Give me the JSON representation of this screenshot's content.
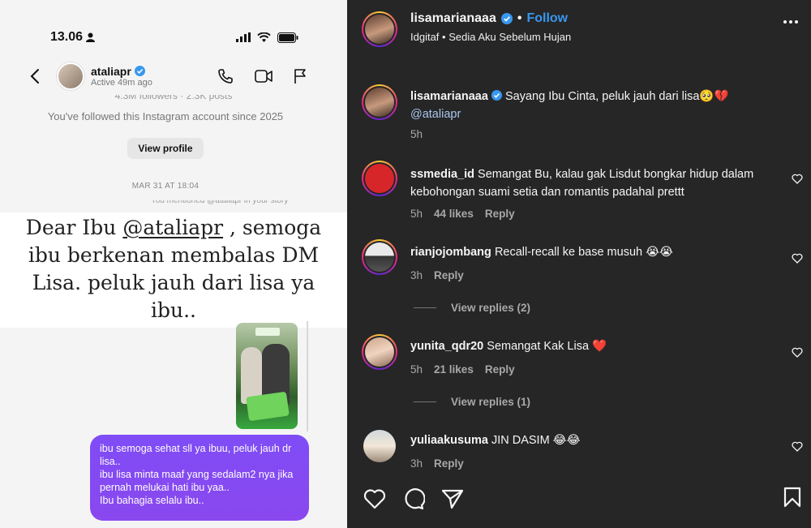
{
  "dm": {
    "status": {
      "time": "13.06"
    },
    "header": {
      "username": "ataliapr",
      "active": "Active 49m ago"
    },
    "followers_partial": "4.3M followers · 2.3K posts",
    "followed_since": "You've followed this Instagram account since 2025",
    "view_profile": "View profile",
    "date": "MAR 31 AT 18:04",
    "mentioned_partial": "You mentioned @ataliapr in your story",
    "overlay": {
      "line_prefix": "Dear Ibu ",
      "mention": "@ataliapr",
      "line_suffix": " , semoga ibu berkenan membalas DM Lisa. peluk jauh dari lisa ya ibu.."
    },
    "bubble": {
      "line1": "ibu semoga sehat sll ya ibuu, peluk jauh dr lisa..",
      "line2": "ibu lisa minta maaf yang sedalam2 nya jika pernah melukai hati ibu yaa..",
      "line3": "Ibu bahagia selalu ibu.."
    }
  },
  "post": {
    "username": "lisamarianaaa",
    "separator": "•",
    "follow": "Follow",
    "music": "Idgitaf • Sedia Aku Sebelum Hujan"
  },
  "comments": [
    {
      "username": "lisamarianaaa",
      "text": "Sayang Ibu Cinta, peluk jauh dari lisa🥺💔",
      "mention": "@ataliapr",
      "time": "5h"
    },
    {
      "username": "ssmedia_id",
      "text": "Semangat Bu, kalau gak Lisdut bongkar hidup dalam kebohongan suami setia dan romantis padahal prettt",
      "time": "5h",
      "likes": "44 likes",
      "reply": "Reply"
    },
    {
      "username": "rianjojombang",
      "text": "Recall-recall ke base musuh 😭😭",
      "time": "3h",
      "reply": "Reply",
      "view_replies": "View replies (2)"
    },
    {
      "username": "yunita_qdr20",
      "text": "Semangat Kak Lisa ❤️",
      "time": "5h",
      "likes": "21 likes",
      "reply": "Reply",
      "view_replies": "View replies (1)"
    },
    {
      "username": "yuliaakusuma",
      "text": "JIN DASIM 😂😂",
      "time": "3h",
      "reply": "Reply"
    }
  ],
  "colors": {
    "dark_bg": "#262626",
    "follow_blue": "#3897f0",
    "bubble_purple": "#7f4cf6",
    "verified_blue": "#3897f0"
  }
}
